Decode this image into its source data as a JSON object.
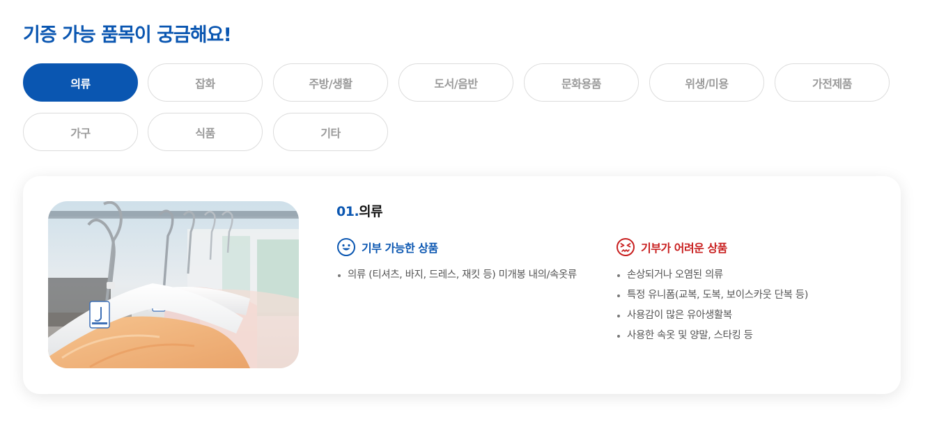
{
  "page": {
    "title": "기증 가능 품목이 궁금해요!"
  },
  "tabs": [
    {
      "label": "의류",
      "active": true
    },
    {
      "label": "잡화",
      "active": false
    },
    {
      "label": "주방/생활",
      "active": false
    },
    {
      "label": "도서/음반",
      "active": false
    },
    {
      "label": "문화용품",
      "active": false
    },
    {
      "label": "위생/미용",
      "active": false
    },
    {
      "label": "가전제품",
      "active": false
    },
    {
      "label": "가구",
      "active": false
    },
    {
      "label": "식품",
      "active": false
    },
    {
      "label": "기타",
      "active": false
    }
  ],
  "detail": {
    "number": "01.",
    "name": "의류",
    "image_icon": "clothes-hangers-photo",
    "allowed": {
      "icon": "smile-face-icon",
      "title": "기부 가능한 상품",
      "items": [
        "의류 (티셔츠, 바지, 드레스, 재킷 등) 미개봉 내의/속옷류"
      ]
    },
    "refused": {
      "icon": "sad-face-icon",
      "title": "기부가 어려운 상품",
      "items": [
        "손상되거나 오염된 의류",
        "특정 유니폼(교복, 도복, 보이스카웃 단복 등)",
        "사용감이 많은 유아생활복",
        "사용한 속옷 및 양말, 스타킹 등"
      ]
    }
  },
  "colors": {
    "accent": "#0a56b1",
    "negative": "#c81e1e",
    "muted_text": "#9a9a9a"
  }
}
